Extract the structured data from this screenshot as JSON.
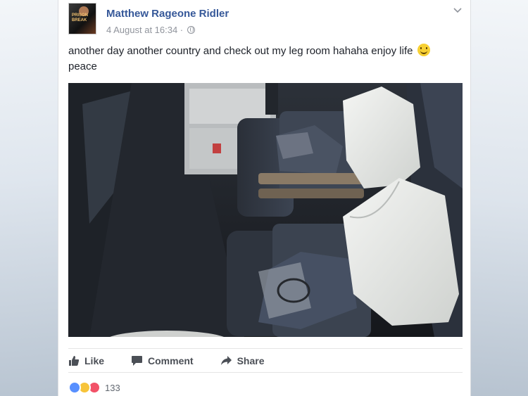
{
  "post": {
    "author": "Matthew Rageone Ridler",
    "timestamp": "4 August at 16:34 ·",
    "avatar_text": "PRISON BREAK",
    "text": "another day another country and check out my leg room hahaha enjoy life",
    "text_line2": "peace"
  },
  "actions": {
    "like_label": "Like",
    "comment_label": "Comment",
    "share_label": "Share"
  },
  "reactions": {
    "count": "133",
    "types": [
      "like",
      "haha",
      "love"
    ]
  },
  "colors": {
    "author_link": "#365899",
    "meta_gray": "#90949c",
    "action_gray": "#4b4f56",
    "like_blue": "#5890ff",
    "love_red": "#f25268",
    "haha_yellow": "#f7c43a"
  }
}
